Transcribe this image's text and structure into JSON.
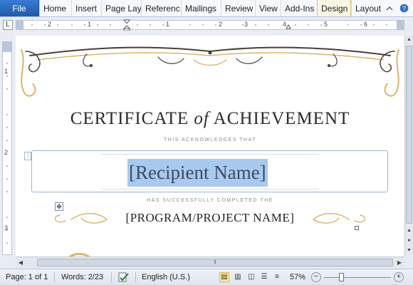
{
  "ribbon": {
    "file_label": "File",
    "tabs": [
      {
        "label": "Home"
      },
      {
        "label": "Insert"
      },
      {
        "label": "Page Lay"
      },
      {
        "label": "Referenc"
      },
      {
        "label": "Mailings"
      },
      {
        "label": "Review"
      },
      {
        "label": "View"
      },
      {
        "label": "Add-Ins"
      },
      {
        "label": "Design",
        "active": true
      },
      {
        "label": "Layout"
      }
    ],
    "right_icons": [
      "minimize-ribbon-icon",
      "help-icon"
    ]
  },
  "ruler": {
    "tab_selector_symbol": "L",
    "h_numbers": [
      "2",
      "1",
      "1",
      "2",
      "3",
      "4",
      "5",
      "6"
    ],
    "v_numbers": [
      "1",
      "2",
      "3"
    ]
  },
  "certificate": {
    "title_before": "CERTIFICATE ",
    "title_of": "of",
    "title_after": " ACHIEVEMENT",
    "acknowledges": "THIS ACKNOWLEDGES THAT",
    "recipient": "[Recipient Name]",
    "completed": "HAS SUCCESSFULLY COMPLETED THE",
    "program": "[PROGRAM/PROJECT NAME]",
    "ornament_color": "#d9b46a",
    "flourish_color": "#4a3f3a"
  },
  "status_bar": {
    "page": "Page: 1 of 1",
    "words": "Words: 2/23",
    "language": "English (U.S.)",
    "zoom_percent": "57%",
    "zoom_level": 0.57
  },
  "colors": {
    "selection": "#a9c9ee",
    "file_tab": "#2a6bc2",
    "active_view": "#fde9a7"
  }
}
